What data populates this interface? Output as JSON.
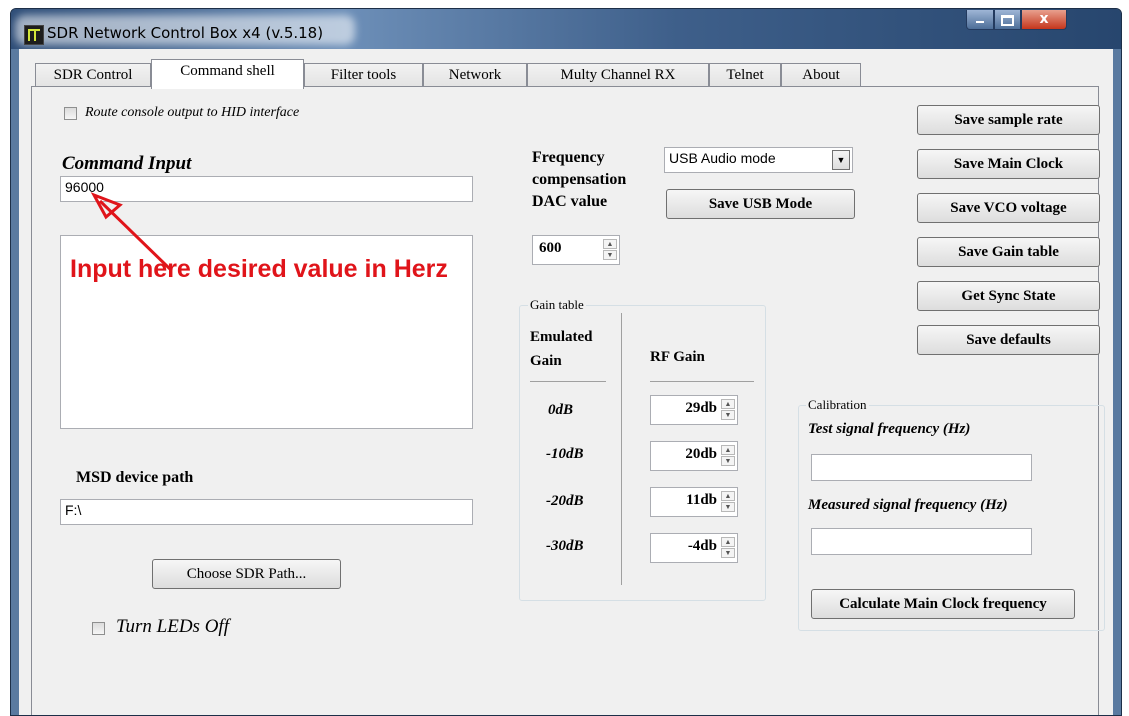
{
  "window": {
    "title": "SDR Network Control Box x4 (v.5.18)",
    "close_glyph": "x"
  },
  "tabs": [
    {
      "label": "SDR Control",
      "active": false
    },
    {
      "label": "Command shell",
      "active": true
    },
    {
      "label": "Filter tools",
      "active": false
    },
    {
      "label": "Network",
      "active": false
    },
    {
      "label": "Multy Channel RX",
      "active": false
    },
    {
      "label": "Telnet",
      "active": false
    },
    {
      "label": "About",
      "active": false
    }
  ],
  "command_shell": {
    "route_console_label": "Route console output to HID interface",
    "command_input_label": "Command Input",
    "command_input_value": "96000",
    "annotation": "Input here desired value in Herz",
    "msd_path_label": "MSD device path",
    "msd_path_value": "F:\\",
    "choose_path_button": "Choose SDR Path...",
    "turn_leds_off_label": "Turn LEDs Off",
    "freq_comp_label_1": "Frequency",
    "freq_comp_label_2": "compensation",
    "freq_comp_label_3": "DAC value",
    "dac_value": "600",
    "usb_mode_selected": "USB Audio mode",
    "save_usb_mode_button": "Save USB Mode",
    "gain_table": {
      "title": "Gain table",
      "col_emulated_1": "Emulated",
      "col_emulated_2": "Gain",
      "col_rf": "RF Gain",
      "rows": [
        {
          "emulated": "0dB",
          "rf": "29db"
        },
        {
          "emulated": "-10dB",
          "rf": "20db"
        },
        {
          "emulated": "-20dB",
          "rf": "11db"
        },
        {
          "emulated": "-30dB",
          "rf": "-4db"
        }
      ]
    },
    "right_buttons": [
      "Save sample rate",
      "Save Main Clock",
      "Save VCO voltage",
      "Save Gain table",
      "Get Sync State",
      "Save defaults"
    ],
    "calibration": {
      "title": "Calibration",
      "test_label": "Test signal frequency (Hz)",
      "test_value": "",
      "measured_label": "Measured signal frequency (Hz)",
      "measured_value": "",
      "calc_button": "Calculate Main Clock frequency"
    }
  },
  "colors": {
    "annotation": "#e0141a",
    "window_frame": "#5a7aa0"
  }
}
